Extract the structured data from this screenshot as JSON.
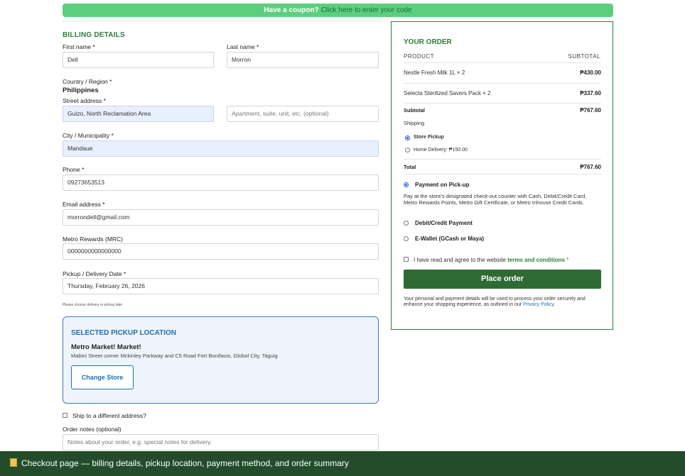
{
  "coupon": {
    "text": "Have a coupon?",
    "link": "Click here to enter your code"
  },
  "billing": {
    "title": "BILLING DETAILS",
    "first_name": {
      "label": "First name *",
      "value": "Dell"
    },
    "last_name": {
      "label": "Last name *",
      "value": "Morron"
    },
    "country": {
      "label": "Country / Region *",
      "value": "Philippines"
    },
    "street": {
      "label": "Street address *",
      "value": "Guizo, North Reclamation Area",
      "apt_placeholder": "Apartment, suite, unit, etc. (optional)"
    },
    "city": {
      "label": "City / Municipality *",
      "value": "Mandaue"
    },
    "phone": {
      "label": "Phone *",
      "value": "09273653513"
    },
    "email": {
      "label": "Email address *",
      "value": "morrondell@gmail.com"
    },
    "mrc": {
      "label": "Metro Rewards (MRC)",
      "value": "0000000000000000"
    },
    "date": {
      "label": "Pickup / Delivery Date *",
      "value": "Thursday, February 26, 2026",
      "hint": "Please choose delivery or pickup date"
    }
  },
  "pickup": {
    "title": "SELECTED PICKUP LOCATION",
    "store_name": "Metro Market! Market!",
    "address": "Mabini Street corner Mckinley Parkway and C5 Road Fort Bonifacio, Global City, Taguig",
    "change_label": "Change Store"
  },
  "ship_different": "Ship to a different address?",
  "notes": {
    "label": "Order notes (optional)",
    "placeholder": "Notes about your order, e.g. special notes for delivery."
  },
  "order": {
    "title": "YOUR ORDER",
    "col_product": "PRODUCT",
    "col_subtotal": "SUBTOTAL",
    "items": [
      {
        "name": "Nestle Fresh Milk 1L  × 2",
        "price": "₱430.00"
      },
      {
        "name": "Selecta Sterilized Savers Pack  × 2",
        "price": "₱337.60"
      }
    ],
    "subtotal_label": "Subtotal",
    "subtotal_value": "₱767.60",
    "shipping_label": "Shipping",
    "shipping_options": [
      "Store Pickup",
      "Home Delivery: ₱150.00"
    ],
    "total_label": "Total",
    "total_value": "₱767.60",
    "payment": {
      "pickup_label": "Payment on Pick-up",
      "pickup_desc": "Pay at the store's designated check-out counter with Cash, Debit/Credit Card, Metro Rewards Points, Metro Gift Certificate, or Metro Inhouse Credit Cards.",
      "card_label": "Debit/Credit Payment",
      "ewallet_label": "E-Wallet (GCash or Maya)"
    },
    "terms": {
      "prefix": "I have read and agree to the website",
      "link": "terms and conditions",
      "star": "*"
    },
    "place_label": "Place order",
    "privacy": {
      "text": "Your personal and payment details will be used to process your order securely and enhance your shopping experience, as outlined in our",
      "link": "Privacy Policy",
      "end": "."
    }
  },
  "footer": {
    "text": "Checkout page — billing details, pickup location, payment method, and order summary"
  }
}
